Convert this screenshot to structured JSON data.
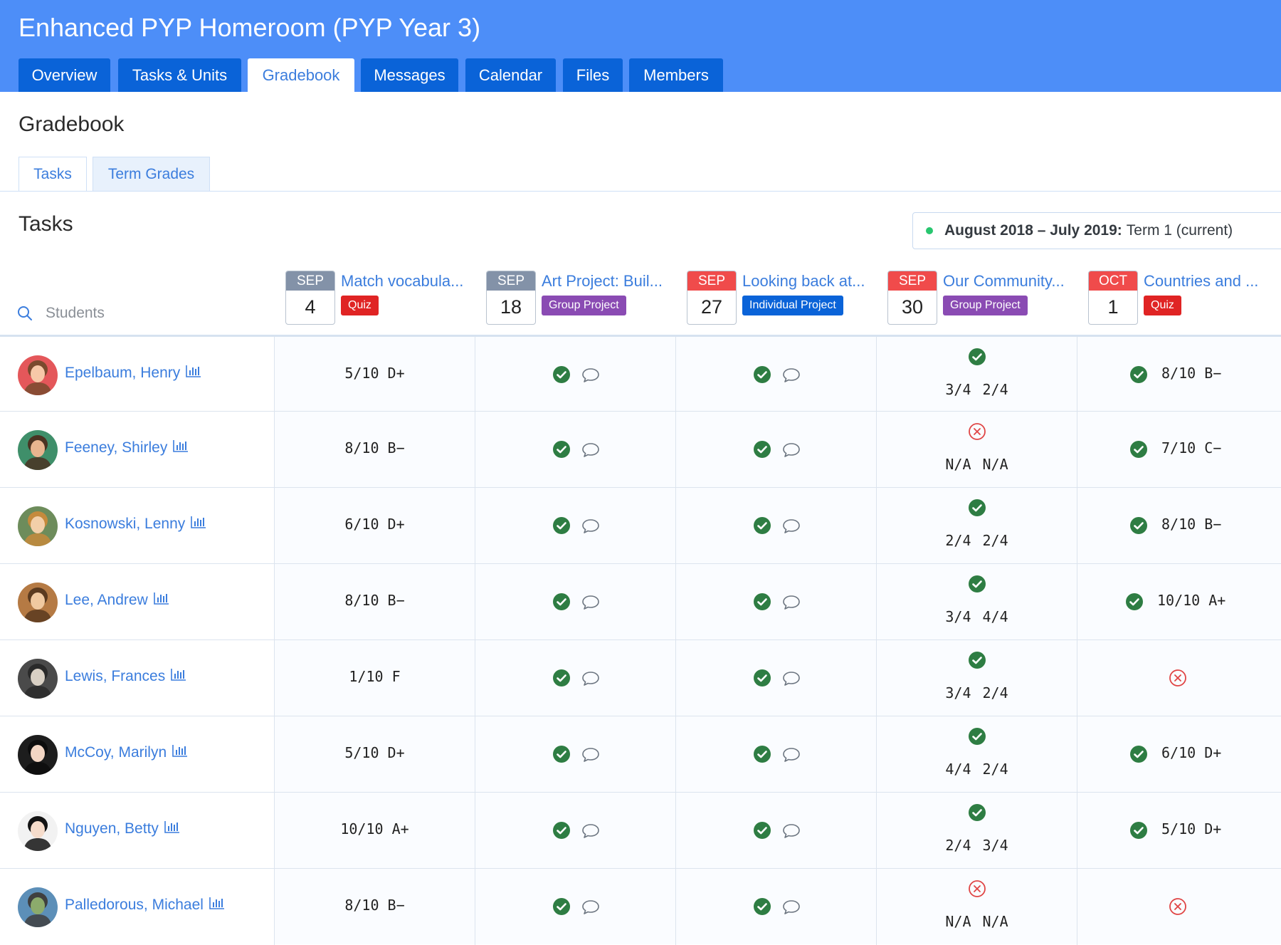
{
  "header": {
    "title": "Enhanced PYP Homeroom (PYP Year 3)",
    "tabs": [
      {
        "label": "Overview"
      },
      {
        "label": "Tasks & Units"
      },
      {
        "label": "Gradebook"
      },
      {
        "label": "Messages"
      },
      {
        "label": "Calendar"
      },
      {
        "label": "Files"
      },
      {
        "label": "Members"
      }
    ],
    "active_tab": "Gradebook"
  },
  "page_title": "Gradebook",
  "sub_tabs": [
    {
      "label": "Tasks"
    },
    {
      "label": "Term Grades"
    }
  ],
  "section_title": "Tasks",
  "term": {
    "range": "August 2018 – July 2019:",
    "label": "Term 1 (current)"
  },
  "search": {
    "placeholder": "Students"
  },
  "tasks": [
    {
      "month": "SEP",
      "day": "4",
      "name": "Match vocabula...",
      "badge": "Quiz"
    },
    {
      "month": "SEP",
      "day": "18",
      "name": "Art Project: Buil...",
      "badge": "Group Project"
    },
    {
      "month": "SEP",
      "day": "27",
      "name": "Looking back at...",
      "badge": "Individual Project"
    },
    {
      "month": "SEP",
      "day": "30",
      "name": "Our Community...",
      "badge": "Group Project"
    },
    {
      "month": "OCT",
      "day": "1",
      "name": "Countries and ...",
      "badge": "Quiz"
    }
  ],
  "colors": {
    "header_bg": "#4d8ef8",
    "tab_bg": "#0a63d8",
    "link": "#3b7ddd",
    "month_past": "#8392a8",
    "month_red": "#f04b4b",
    "badge_quiz": "#e02424",
    "badge_group": "#8a4bb3",
    "badge_individual": "#0a63d8",
    "check": "#2e7d43",
    "missing": "#e04545"
  },
  "students": [
    {
      "name": "Epelbaum, Henry",
      "t1": "5/10 D+",
      "t4_status": "check",
      "t4": [
        "3/4",
        "2/4"
      ],
      "t5_status": "check",
      "t5": "8/10 B−"
    },
    {
      "name": "Feeney, Shirley",
      "t1": "8/10 B−",
      "t4_status": "missing",
      "t4": [
        "N/A",
        "N/A"
      ],
      "t5_status": "check",
      "t5": "7/10 C−"
    },
    {
      "name": "Kosnowski, Lenny",
      "t1": "6/10 D+",
      "t4_status": "check",
      "t4": [
        "2/4",
        "2/4"
      ],
      "t5_status": "check",
      "t5": "8/10 B−"
    },
    {
      "name": "Lee, Andrew",
      "t1": "8/10 B−",
      "t4_status": "check",
      "t4": [
        "3/4",
        "4/4"
      ],
      "t5_status": "check",
      "t5": "10/10 A+"
    },
    {
      "name": "Lewis, Frances",
      "t1": "1/10 F",
      "t4_status": "check",
      "t4": [
        "3/4",
        "2/4"
      ],
      "t5_status": "missing",
      "t5": ""
    },
    {
      "name": "McCoy, Marilyn",
      "t1": "5/10 D+",
      "t4_status": "check",
      "t4": [
        "4/4",
        "2/4"
      ],
      "t5_status": "check",
      "t5": "6/10 D+"
    },
    {
      "name": "Nguyen, Betty",
      "t1": "10/10 A+",
      "t4_status": "check",
      "t4": [
        "2/4",
        "3/4"
      ],
      "t5_status": "check",
      "t5": "5/10 D+"
    },
    {
      "name": "Palledorous, Michael",
      "t1": "8/10 B−",
      "t4_status": "missing",
      "t4": [
        "N/A",
        "N/A"
      ],
      "t5_status": "missing",
      "t5": ""
    }
  ]
}
